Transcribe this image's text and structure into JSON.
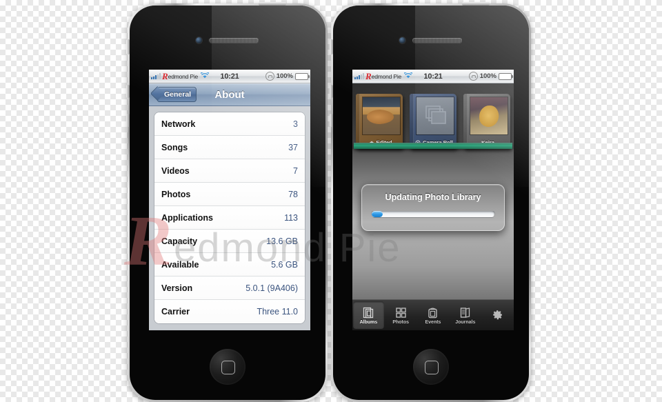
{
  "watermark": {
    "logo": "R",
    "text": "edmond Pie"
  },
  "phones": {
    "left": {
      "name": "iphone-settings-about",
      "status_bar": {
        "carrier_logo": "R",
        "carrier": "edmond Pie",
        "wifi_icon": "wifi-icon",
        "time": "10:21",
        "lock_icon": "rotation-lock-icon",
        "battery_pct": "100%",
        "battery_icon": "battery-charging-icon"
      },
      "navbar": {
        "back_label": "General",
        "title": "About"
      },
      "rows": [
        {
          "label": "Network",
          "value": "3"
        },
        {
          "label": "Songs",
          "value": "37"
        },
        {
          "label": "Videos",
          "value": "7"
        },
        {
          "label": "Photos",
          "value": "78"
        },
        {
          "label": "Applications",
          "value": "113"
        },
        {
          "label": "Capacity",
          "value": "13.6 GB"
        },
        {
          "label": "Available",
          "value": "5.6 GB"
        },
        {
          "label": "Version",
          "value": "5.0.1 (9A406)"
        },
        {
          "label": "Carrier",
          "value": "Three 11.0"
        }
      ]
    },
    "right": {
      "name": "iphone-photos-albums",
      "status_bar": {
        "carrier_logo": "R",
        "carrier": "edmond Pie",
        "wifi_icon": "wifi-icon",
        "time": "10:21",
        "lock_icon": "rotation-lock-icon",
        "battery_pct": "100%",
        "battery_icon": "battery-charging-icon"
      },
      "albums": [
        {
          "title": "Edited",
          "badge": "edited-badge-icon"
        },
        {
          "title": "Camera Roll",
          "badge": "camera-badge-icon"
        },
        {
          "title": "Keira",
          "badge": ""
        }
      ],
      "dialog": {
        "title": "Updating Photo Library",
        "progress_percent": 9
      },
      "tabs": [
        {
          "label": "Albums",
          "icon": "albums-icon",
          "selected": true
        },
        {
          "label": "Photos",
          "icon": "photos-grid-icon",
          "selected": false
        },
        {
          "label": "Events",
          "icon": "events-icon",
          "selected": false
        },
        {
          "label": "Journals",
          "icon": "journals-icon",
          "selected": false
        },
        {
          "label": "",
          "icon": "gear-icon",
          "selected": false
        }
      ]
    }
  },
  "colors": {
    "accent_blue": "#2f9ae8",
    "dialog_blue": "#1f3557",
    "row_value_blue": "#3a537e",
    "shelf_green": "#2aa37a",
    "carrier_red": "#d8252c",
    "battery_green": "#3fa414"
  }
}
